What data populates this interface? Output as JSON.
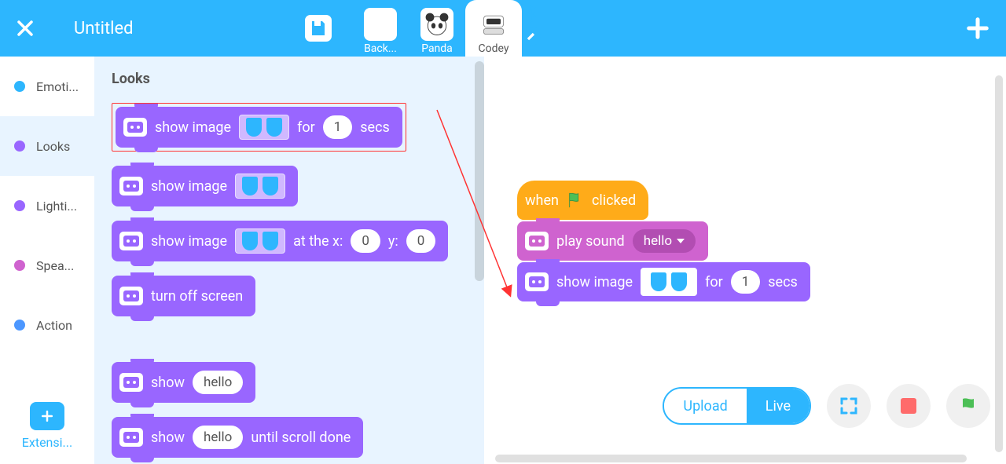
{
  "header": {
    "title": "Untitled",
    "devices": [
      {
        "label": "Back..."
      },
      {
        "label": "Panda"
      },
      {
        "label": "Codey"
      }
    ]
  },
  "categories": [
    {
      "label": "Emoti...",
      "color": "#2DB6FE"
    },
    {
      "label": "Looks",
      "color": "#9966FF"
    },
    {
      "label": "Lighti...",
      "color": "#9966FF"
    },
    {
      "label": "Spea...",
      "color": "#CF63CF"
    },
    {
      "label": "Action",
      "color": "#4C97FF"
    }
  ],
  "extensions_label": "Extensi...",
  "palette": {
    "title": "Looks",
    "blocks": {
      "show_image_for_secs": {
        "pre": "show image",
        "mid": "for",
        "val": "1",
        "post": "secs"
      },
      "show_image": {
        "pre": "show image"
      },
      "show_image_at": {
        "pre": "show image",
        "mid": "at the x:",
        "x": "0",
        "mid2": "y:",
        "y": "0"
      },
      "turn_off_screen": {
        "label": "turn off screen"
      },
      "show_text": {
        "pre": "show",
        "val": "hello"
      },
      "show_text_scroll": {
        "pre": "show",
        "val": "hello",
        "post": "until scroll done"
      }
    }
  },
  "canvas": {
    "when_clicked": {
      "pre": "when",
      "post": "clicked"
    },
    "play_sound": {
      "pre": "play sound",
      "val": "hello"
    },
    "show_image_for_secs": {
      "pre": "show image",
      "mid": "for",
      "val": "1",
      "post": "secs"
    }
  },
  "controls": {
    "upload": "Upload",
    "live": "Live"
  }
}
